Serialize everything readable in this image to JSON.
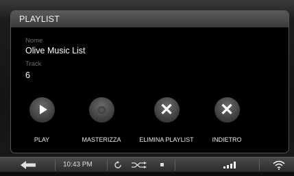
{
  "panel": {
    "title": "PLAYLIST"
  },
  "details": {
    "name_label": "Nome",
    "name_value": "Olive Music List",
    "track_label": "Track",
    "track_value": "6"
  },
  "actions": [
    {
      "label": "PLAY",
      "icon": "play-icon"
    },
    {
      "label": "MASTERIZZA",
      "icon": "disc-icon"
    },
    {
      "label": "ELIMINA PLAYLIST",
      "icon": "close-icon"
    },
    {
      "label": "INDIETRO",
      "icon": "close-icon"
    }
  ],
  "statusbar": {
    "time": "10:43 PM",
    "icons": [
      "back-arrow-icon",
      "repeat-icon",
      "shuffle-icon",
      "stop-icon",
      "signal-bars-icon",
      "wifi-icon"
    ]
  }
}
